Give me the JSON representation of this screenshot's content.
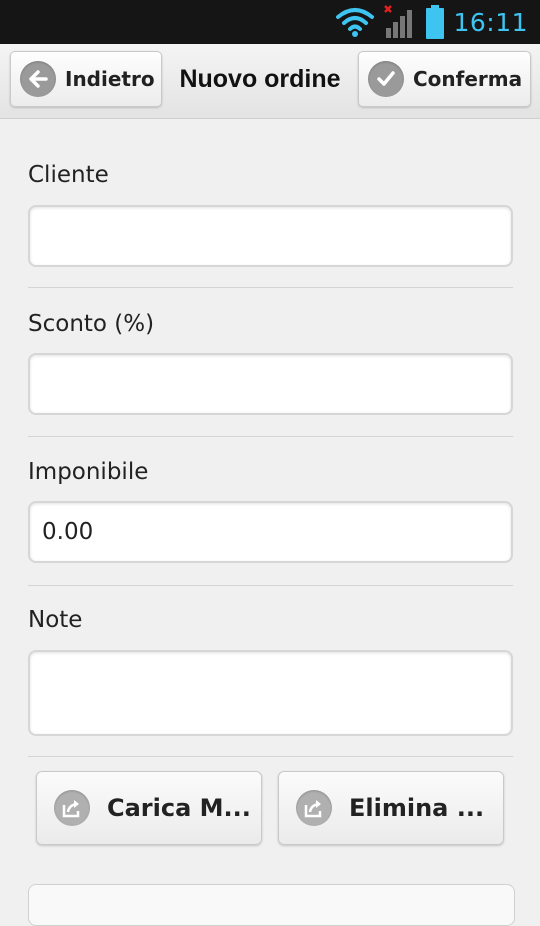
{
  "status_bar": {
    "time": "16:11",
    "icons": [
      "wifi-icon",
      "signal-icon",
      "battery-icon"
    ],
    "accent_color": "#3ec4f0"
  },
  "header": {
    "back_label": "Indietro",
    "title": "Nuovo ordine",
    "confirm_label": "Conferma"
  },
  "form": {
    "cliente": {
      "label": "Cliente",
      "value": ""
    },
    "sconto": {
      "label": "Sconto (%)",
      "value": ""
    },
    "imponibile": {
      "label": "Imponibile",
      "value": "0.00"
    },
    "note": {
      "label": "Note",
      "value": ""
    }
  },
  "actions": {
    "load_label": "Carica M...",
    "delete_label": "Elimina ..."
  }
}
